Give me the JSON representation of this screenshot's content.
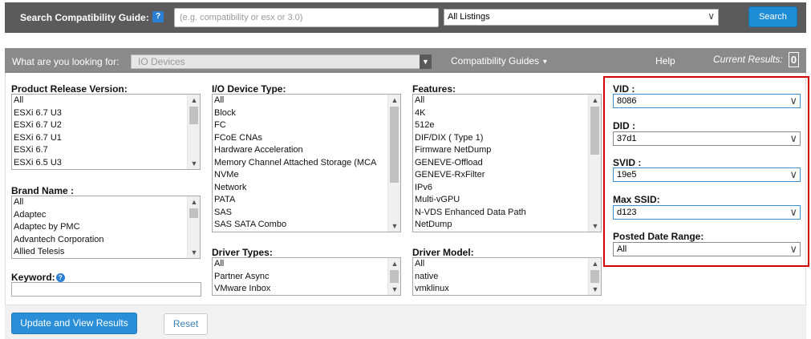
{
  "search": {
    "label": "Search Compatibility Guide:",
    "help_icon": "?",
    "placeholder": "(e.g. compatibility or esx or 3.0)",
    "listings_value": "All Listings",
    "button": "Search"
  },
  "nav": {
    "question": "What are you looking for:",
    "type_value": "IO Devices",
    "compat_guides": "Compatibility Guides",
    "help": "Help",
    "current_results_label": "Current Results:",
    "current_results_count": "0"
  },
  "product_release": {
    "label": "Product Release Version:",
    "options": [
      "All",
      "ESXi 6.7 U3",
      "ESXi 6.7 U2",
      "ESXi 6.7 U1",
      "ESXi 6.7",
      "ESXi 6.5 U3"
    ]
  },
  "brand": {
    "label": "Brand Name :",
    "options": [
      "All",
      "Adaptec",
      "Adaptec by PMC",
      "Advantech Corporation",
      "Allied Telesis"
    ]
  },
  "keyword": {
    "label": "Keyword:",
    "help_icon": "?"
  },
  "io_device_type": {
    "label": "I/O Device Type:",
    "options": [
      "All",
      "Block",
      "FC",
      "FCoE CNAs",
      "Hardware Acceleration",
      "Memory Channel Attached Storage (MCA",
      "NVMe",
      "Network",
      "PATA",
      "SAS",
      "SAS SATA Combo"
    ]
  },
  "driver_types": {
    "label": "Driver Types:",
    "options": [
      "All",
      "Partner Async",
      "VMware Inbox"
    ]
  },
  "features": {
    "label": "Features:",
    "options": [
      "All",
      "4K",
      "512e",
      "DIF/DIX ( Type 1)",
      "Firmware NetDump",
      "GENEVE-Offload",
      "GENEVE-RxFilter",
      "IPv6",
      "Multi-vGPU",
      "N-VDS Enhanced Data Path",
      "NetDump"
    ]
  },
  "driver_model": {
    "label": "Driver Model:",
    "options": [
      "All",
      "native",
      "vmklinux"
    ]
  },
  "vid": {
    "label": "VID :",
    "value": "8086"
  },
  "did": {
    "label": "DID :",
    "value": "37d1"
  },
  "svid": {
    "label": "SVID :",
    "value": "19e5"
  },
  "max_ssid": {
    "label": "Max SSID:",
    "value": "d123"
  },
  "posted_date": {
    "label": "Posted Date Range:",
    "value": "All"
  },
  "footer": {
    "update": "Update and View Results",
    "reset": "Reset"
  }
}
